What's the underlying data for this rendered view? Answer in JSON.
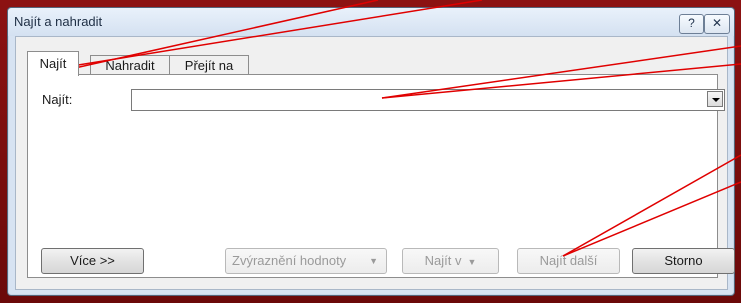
{
  "window": {
    "title": "Najít a nahradit",
    "help_glyph": "?",
    "close_glyph": "✕"
  },
  "tabs": [
    {
      "label": "Najít",
      "active": true
    },
    {
      "label": "Nahradit",
      "active": false
    },
    {
      "label": "Přejít na",
      "active": false
    }
  ],
  "find": {
    "label": "Najít:",
    "value": ""
  },
  "buttons": {
    "more": "Více >>",
    "highlight": "Zvýraznění hodnoty",
    "find_in": "Najít v",
    "find_next": "Najít další",
    "cancel": "Storno"
  },
  "colors": {
    "backdrop": "#7a0d0d",
    "annotation_line": "#e00000"
  }
}
